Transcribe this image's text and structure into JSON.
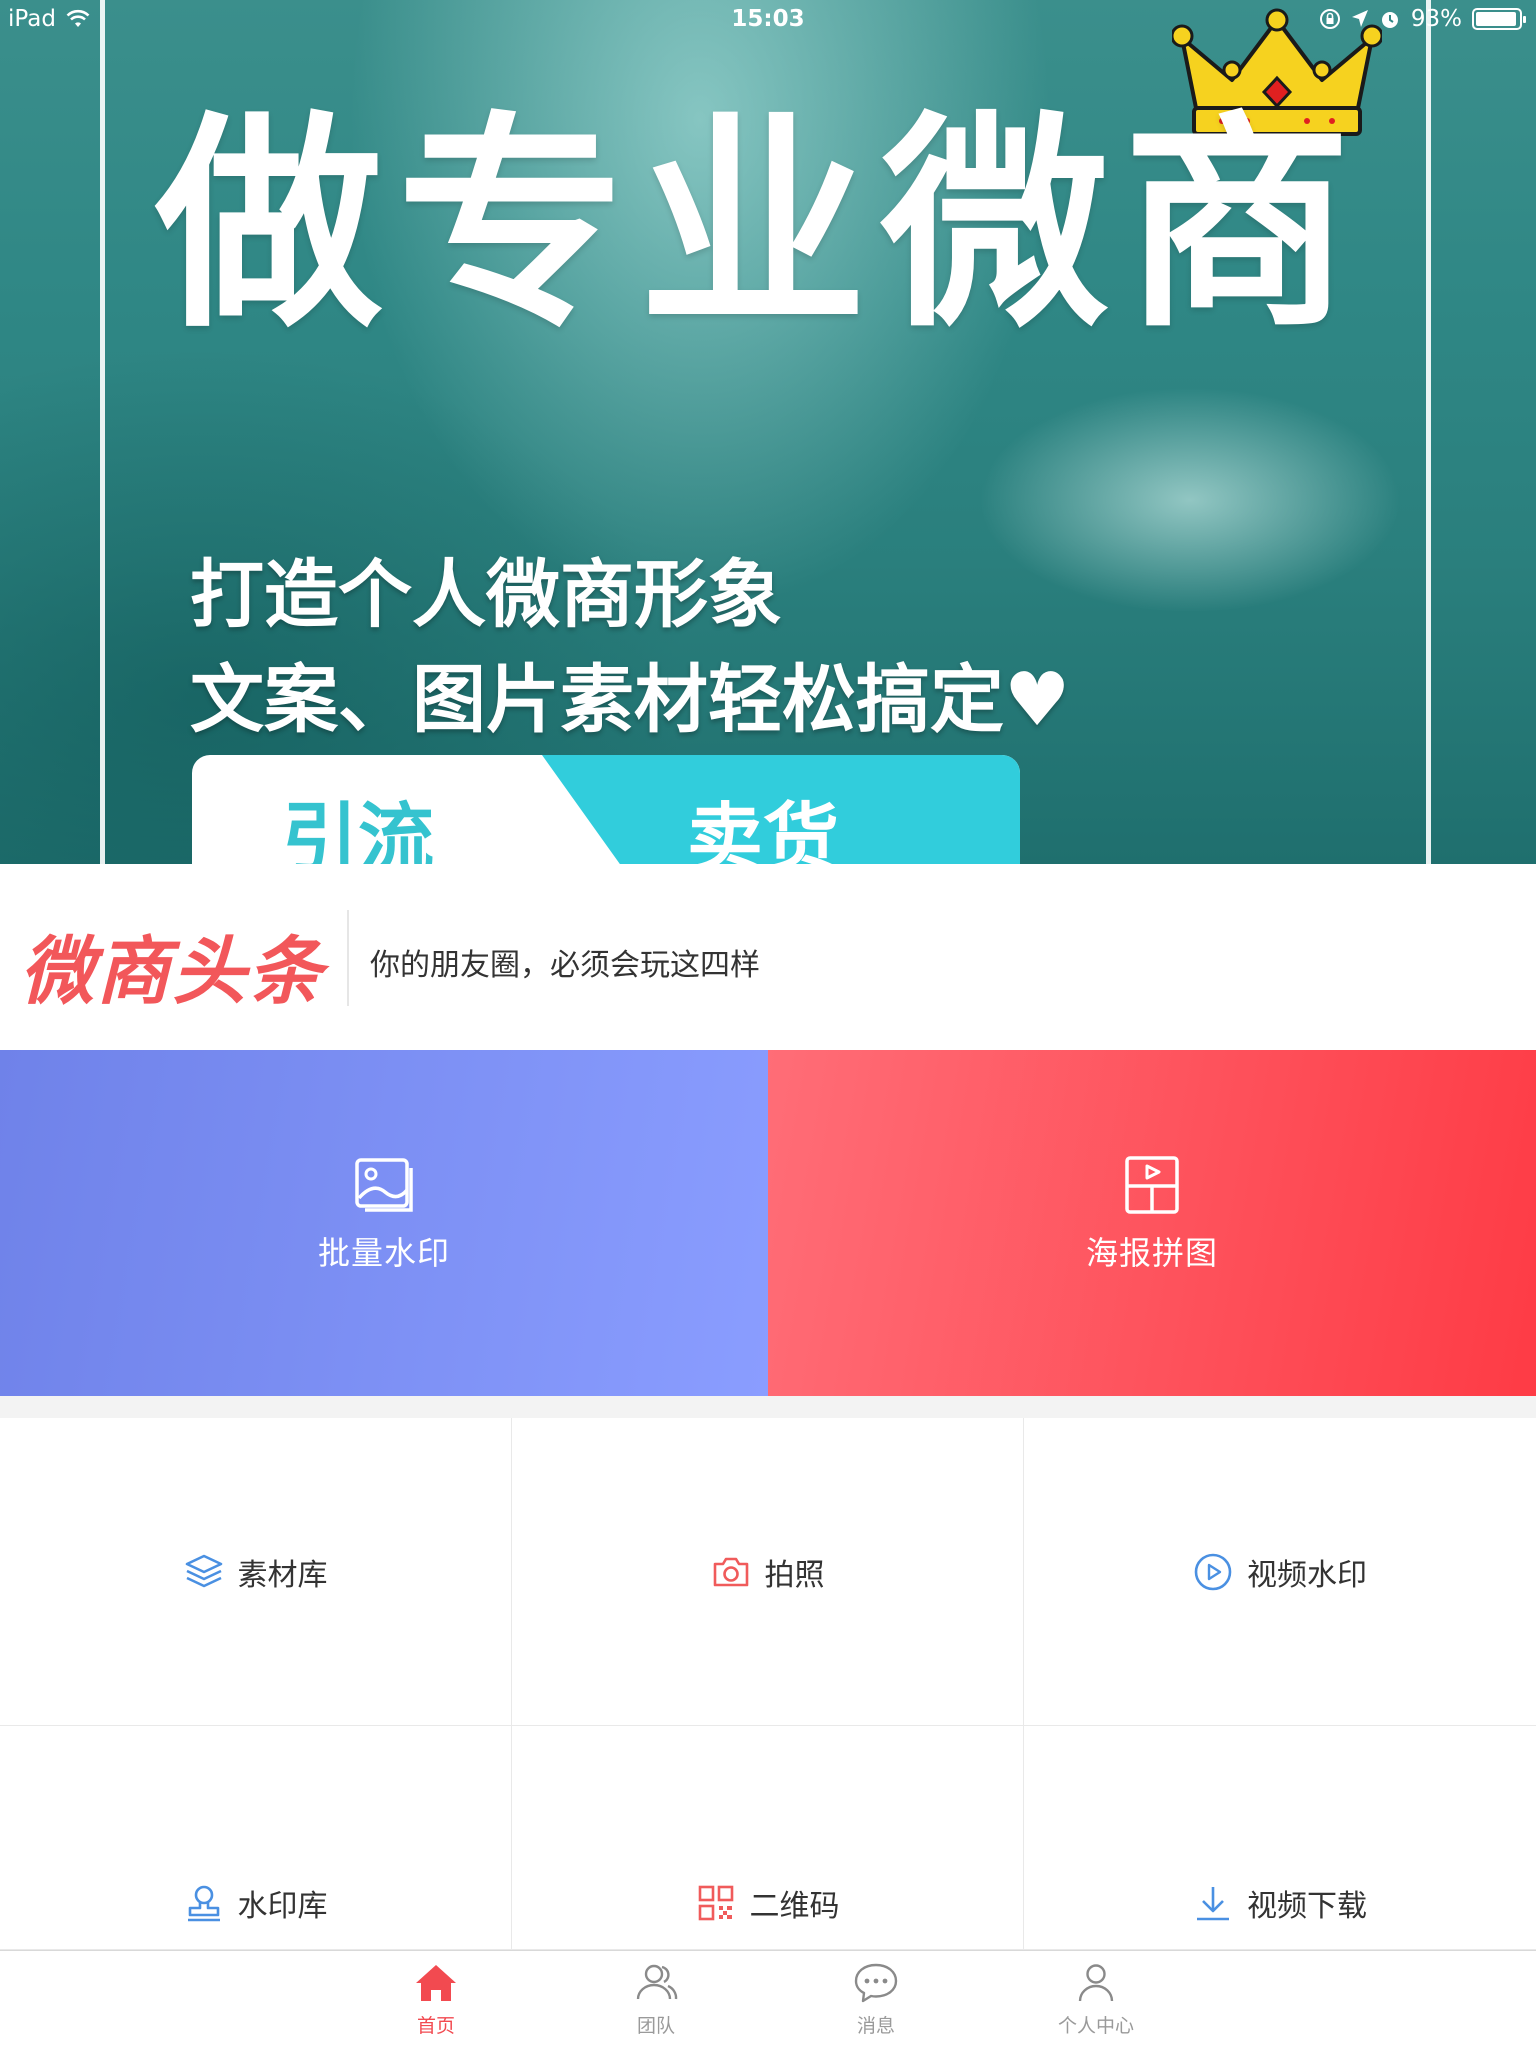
{
  "status_bar": {
    "device": "iPad",
    "time": "15:03",
    "battery": "93%"
  },
  "banner": {
    "title": "做专业微商",
    "subtitle_line1": "打造个人微商形象",
    "subtitle_line2": "文案、图片素材轻松搞定♥",
    "pill_left": "引流",
    "pill_right": "卖货"
  },
  "headline": {
    "logo_text": "微商头条",
    "text": "你的朋友圈，必须会玩这四样"
  },
  "features": [
    {
      "label": "批量水印",
      "icon": "image-icon",
      "color_from": "#6f82e9",
      "color_to": "#8a9dff"
    },
    {
      "label": "海报拼图",
      "icon": "poster-icon",
      "color_from": "#ff6d77",
      "color_to": "#fe3b45"
    }
  ],
  "grid": [
    {
      "label": "素材库",
      "icon": "layers-icon",
      "icon_color": "#4a90e2"
    },
    {
      "label": "拍照",
      "icon": "camera-icon",
      "icon_color": "#f05b5b"
    },
    {
      "label": "视频水印",
      "icon": "play-circle-icon",
      "icon_color": "#4a90e2"
    },
    {
      "label": "水印库",
      "icon": "stamp-icon",
      "icon_color": "#4a90e2"
    },
    {
      "label": "二维码",
      "icon": "qrcode-icon",
      "icon_color": "#f05b5b"
    },
    {
      "label": "视频下载",
      "icon": "download-icon",
      "icon_color": "#4a90e2"
    }
  ],
  "tabbar": [
    {
      "label": "首页",
      "icon": "home-icon",
      "active": true
    },
    {
      "label": "团队",
      "icon": "team-icon",
      "active": false
    },
    {
      "label": "消息",
      "icon": "message-icon",
      "active": false
    },
    {
      "label": "个人中心",
      "icon": "user-icon",
      "active": false
    }
  ],
  "colors": {
    "accent_red": "#f24a50",
    "tab_inactive": "#9a9a9a",
    "banner_teal": "#2f8785",
    "pill_cyan": "#31cddc"
  }
}
